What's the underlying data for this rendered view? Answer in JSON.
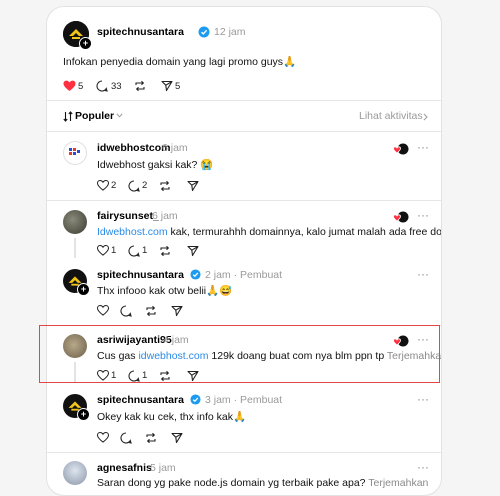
{
  "post": {
    "author": "spitechnusantara",
    "time": "12 jam",
    "text": "Infokan penyedia domain yang lagi promo guys🙏",
    "likes": "5",
    "comments": "33",
    "shares": "5"
  },
  "toolbar": {
    "sort_label": "Populer",
    "activity_label": "Lihat aktivitas"
  },
  "replies": [
    {
      "author": "idwebhostcom",
      "time": "6 jam",
      "text": "Idwebhost gaksi kak? 😭",
      "likes": "2",
      "comments": "2",
      "reposts": "",
      "author_badge": ""
    },
    {
      "author": "fairysunset_",
      "time": "6 jam",
      "link": "Idwebhost.com",
      "text": " kak, termurahhh domainnya, kalo jumat malah ada free domain",
      "likes": "1",
      "comments": "1",
      "reposts": ""
    },
    {
      "author": "spitechnusantara",
      "time": "2 jam",
      "creator": "Pembuat",
      "text": "Thx infooo kak otw belii🙏😅",
      "likes": "",
      "comments": "",
      "reposts": ""
    },
    {
      "author": "asriwijayanti95",
      "time": "4 jam",
      "text_pre": "Cus gas ",
      "link": "idwebhost.com",
      "text": " 129k doang buat com nya blm ppn tp",
      "translate": "Terjemahkan",
      "likes": "1",
      "comments": "1",
      "reposts": ""
    },
    {
      "author": "spitechnusantara",
      "time": "3 jam",
      "creator": "Pembuat",
      "text": "Okey kak ku cek, thx info kak🙏",
      "likes": "",
      "comments": "",
      "reposts": ""
    },
    {
      "author": "agnesafnis",
      "time": "5 jam",
      "text": "Saran dong yg pake node.js domain yg terbaik pake apa?",
      "translate": "Terjemahkan"
    }
  ],
  "colors": {
    "like": "#ff3040",
    "link": "#2a8be6",
    "highlight": "#e04848"
  },
  "icons": [
    "heart-icon",
    "comment-icon",
    "repost-icon",
    "share-icon",
    "more-icon",
    "verified-icon",
    "follow-plus-icon"
  ]
}
